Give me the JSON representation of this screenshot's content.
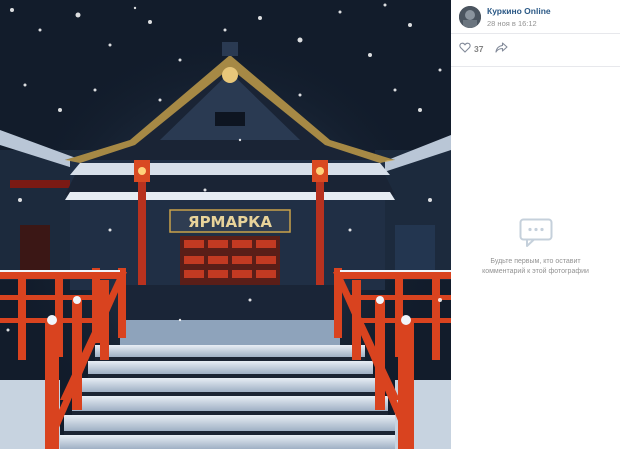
{
  "post": {
    "author_name": "Куркино Online",
    "date": "28 ноя в 16:12",
    "likes": "37",
    "empty_comments_text": "Будьте первым, кто оставит комментарий к этой фотографии"
  },
  "photo": {
    "sign_text": "ЯРМАРКА"
  },
  "icons": {
    "like": "heart-icon",
    "share": "share-arrow-icon",
    "comments": "speech-bubble-icon"
  },
  "colors": {
    "link": "#2a5885",
    "meta": "#939393",
    "railing": "#d9431f"
  }
}
